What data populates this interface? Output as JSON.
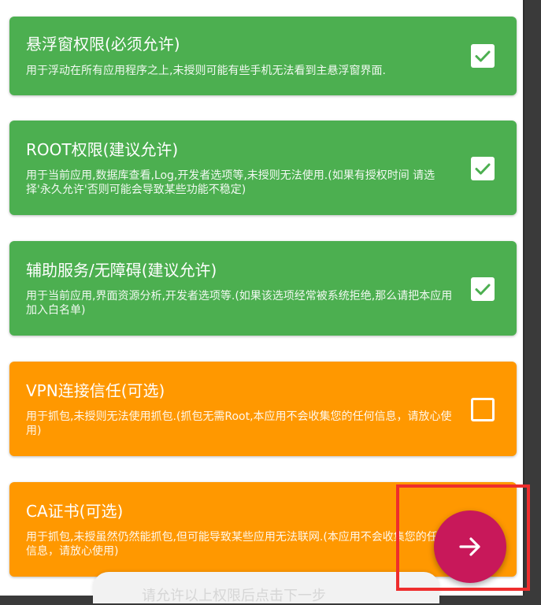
{
  "permissions": [
    {
      "title": "悬浮窗权限(必须允许)",
      "description": "用于浮动在所有应用程序之上,未授则可能有些手机无法看到主悬浮窗界面.",
      "checked": true,
      "color": "#4caf50"
    },
    {
      "title": "ROOT权限(建议允许)",
      "description": "用于当前应用,数据库查看,Log,开发者选项等,未授则无法使用.(如果有授权时间 请选择'永久允许'否则可能会导致某些功能不稳定)",
      "checked": true,
      "color": "#4caf50"
    },
    {
      "title": "辅助服务/无障碍(建议允许)",
      "description": "用于当前应用,界面资源分析,开发者选项等.(如果该选项经常被系统拒绝,那么请把本应用加入白名单)",
      "checked": true,
      "color": "#4caf50"
    },
    {
      "title": "VPN连接信任(可选)",
      "description": "用于抓包,未授则无法使用抓包.(抓包无需Root,本应用不会收集您的任何信息，请放心使用)",
      "checked": false,
      "color": "#ff9800"
    },
    {
      "title": "CA证书(可选)",
      "description": "用于抓包,未授虽然仍然能抓包,但可能导致某些应用无法联网.(本应用不会收集您的任何信息，请放心使用)",
      "checked": false,
      "color": "#ff9800"
    }
  ],
  "next_button": {
    "icon": "arrow-right-icon",
    "color": "#c8185a"
  },
  "bottom_hint": {
    "text": "请允许以上权限后点击下一步"
  },
  "highlight_color": "#ee2d2d"
}
